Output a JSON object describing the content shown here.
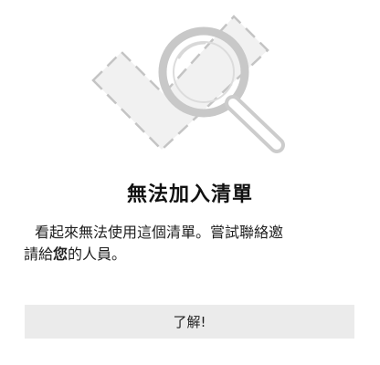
{
  "dialog": {
    "title": "無法加入清單",
    "message_part1": "看起來無法使用這個清單。嘗試聯絡邀請給",
    "message_emphasis": "您",
    "message_part2": "的人員。",
    "ok_label": "了解!"
  },
  "illustration": {
    "icon": "magnifier-over-dashed-checkmark",
    "color": "#c4c4c4"
  }
}
